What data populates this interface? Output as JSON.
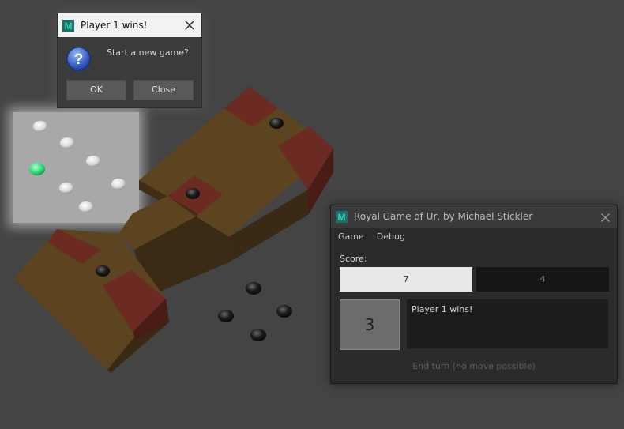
{
  "dialog": {
    "title": "Player 1 wins!",
    "message": "Start a new game?",
    "ok_label": "OK",
    "close_label": "Close"
  },
  "window": {
    "title": "Royal Game of Ur, by Michael Stickler",
    "menu": [
      "Game",
      "Debug"
    ],
    "score_label": "Score:",
    "score_player1": "7",
    "score_player2": "4",
    "dice_value": "3",
    "status_text": "Player 1 wins!",
    "end_turn_label": "End turn (no move possible)"
  },
  "colors": {
    "background": "#444444",
    "board_wood": "#5c4420",
    "rosette_red": "#6f2a22",
    "white_piece": "#e8e8e8",
    "black_piece": "#1a1a1a",
    "highlight_piece": "#32e07a",
    "app_icon": "#2bb3a0"
  },
  "icons": [
    "app-logo-icon",
    "question-icon",
    "close-icon"
  ]
}
